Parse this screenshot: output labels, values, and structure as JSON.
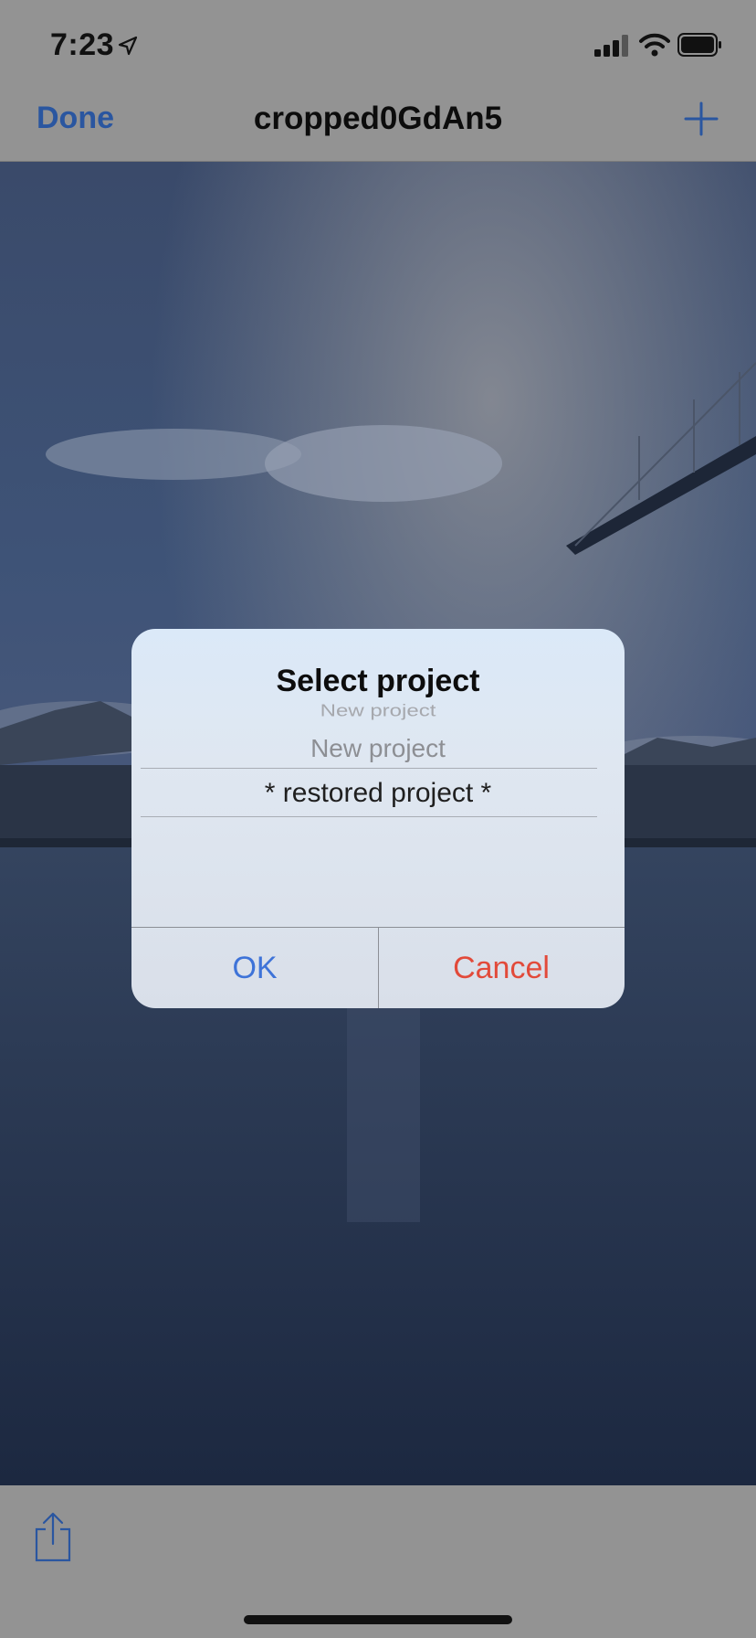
{
  "status_bar": {
    "time": "7:23",
    "icons": [
      "location-arrow-icon",
      "cellular-signal-icon",
      "wifi-icon",
      "battery-icon"
    ]
  },
  "nav": {
    "done_label": "Done",
    "title": "cropped0GdAn5",
    "add_icon": "plus-icon"
  },
  "dialog": {
    "title": "Select project",
    "picker_items": [
      "New project",
      "New project",
      "* restored project *"
    ],
    "selected_index": 2,
    "ok_label": "OK",
    "cancel_label": "Cancel"
  },
  "toolbar": {
    "share_icon": "share-icon"
  },
  "colors": {
    "accent": "#2a56a0",
    "ok": "#3e73d8",
    "cancel": "#e24a3a"
  }
}
